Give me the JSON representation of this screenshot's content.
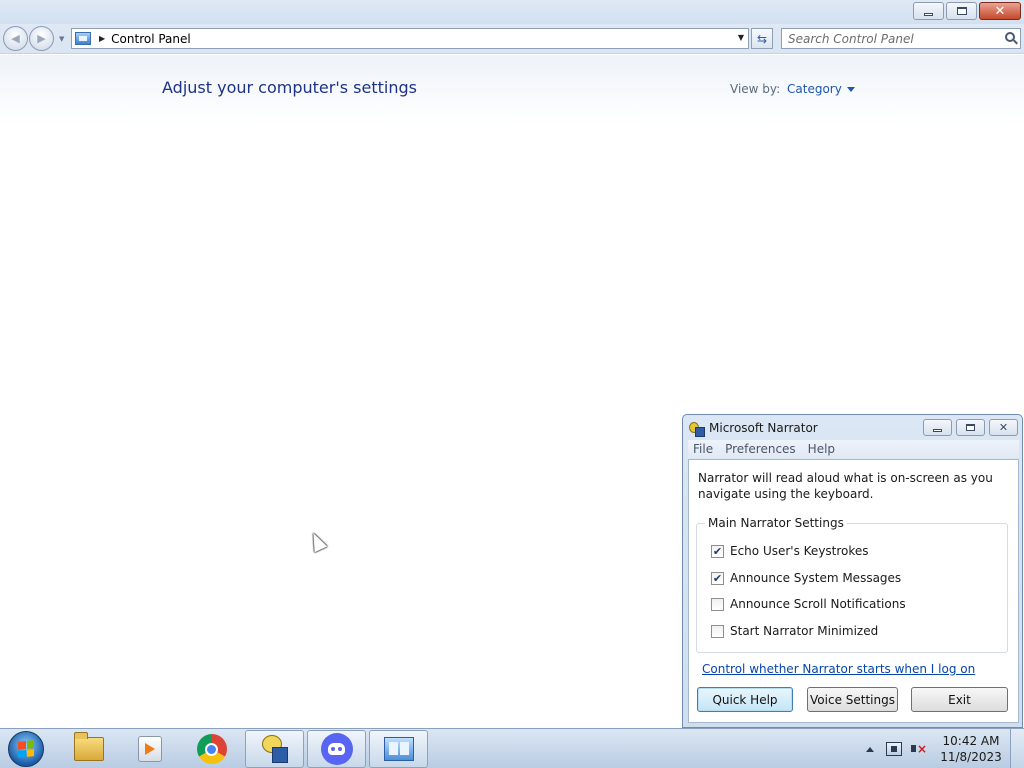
{
  "window": {
    "caption_buttons": {
      "minimize_icon": "minimize-icon",
      "restore_icon": "restore-icon",
      "close_icon": "close-icon"
    }
  },
  "navbar": {
    "back_icon": "back-arrow-icon",
    "forward_icon": "forward-arrow-icon",
    "address": "Control Panel",
    "search_placeholder": "Search Control Panel",
    "refresh_icon": "refresh-icon"
  },
  "main": {
    "page_title": "Adjust your computer's settings",
    "view_by_label": "View by:",
    "view_by_value": "Category"
  },
  "narrator": {
    "title": "Microsoft Narrator",
    "menus": [
      "File",
      "Preferences",
      "Help"
    ],
    "description": "Narrator will read aloud what is on-screen as you navigate using the keyboard.",
    "group_title": "Main Narrator Settings",
    "options": [
      {
        "label": "Echo User's Keystrokes",
        "checked": true
      },
      {
        "label": "Announce System Messages",
        "checked": true
      },
      {
        "label": "Announce Scroll Notifications",
        "checked": false
      },
      {
        "label": "Start Narrator Minimized",
        "checked": false
      }
    ],
    "link": "Control whether Narrator starts when I log on",
    "buttons": {
      "quick_help": "Quick Help",
      "voice_settings": "Voice Settings",
      "exit": "Exit"
    }
  },
  "taskbar": {
    "apps": [
      {
        "name": "windows-explorer",
        "icon": "folder-icon",
        "active": false
      },
      {
        "name": "media-player",
        "icon": "media-player-icon",
        "active": false
      },
      {
        "name": "chrome",
        "icon": "chrome-icon",
        "active": false
      },
      {
        "name": "narrator",
        "icon": "narrator-icon",
        "active": true
      },
      {
        "name": "discord",
        "icon": "discord-icon",
        "active": true
      },
      {
        "name": "control-panel",
        "icon": "control-panel-icon",
        "active": true
      }
    ],
    "clock": {
      "time": "10:42 AM",
      "date": "11/8/2023"
    }
  }
}
